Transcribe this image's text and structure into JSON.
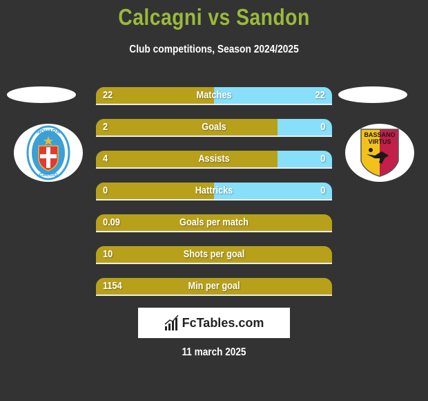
{
  "header": {
    "title": "Calcagni vs Sandon",
    "subtitle": "Club competitions, Season 2024/2025"
  },
  "teams": {
    "left": {
      "name": "Novara Calcio",
      "logo_icon": "novara-calcio-crest-icon",
      "crest_top_text": "NOVARA",
      "crest_bottom_text": "CALCIO"
    },
    "right": {
      "name": "Bassano Virtus",
      "logo_icon": "bassano-virtus-crest-icon",
      "crest_top_text": "BASSANO",
      "crest_mid_text": "VIRTUS"
    }
  },
  "colors": {
    "background": "#333333",
    "title": "#9ab93c",
    "left_bar": "#b8a11a",
    "right_bar": "#87dff9"
  },
  "stats": [
    {
      "label": "Matches",
      "left": "22",
      "right": "22",
      "left_share": 0.5
    },
    {
      "label": "Goals",
      "left": "2",
      "right": "0",
      "left_share": 0.77
    },
    {
      "label": "Assists",
      "left": "4",
      "right": "0",
      "left_share": 0.77
    },
    {
      "label": "Hattricks",
      "left": "0",
      "right": "0",
      "left_share": 0.5
    },
    {
      "label": "Goals per match",
      "left": "0.09",
      "right": "",
      "left_share": 1
    },
    {
      "label": "Shots per goal",
      "left": "10",
      "right": "",
      "left_share": 1
    },
    {
      "label": "Min per goal",
      "left": "1154",
      "right": "",
      "left_share": 1
    }
  ],
  "brand": {
    "name": "FcTables.com",
    "icon": "bar-chart-icon"
  },
  "footer": {
    "date": "11 march 2025"
  }
}
